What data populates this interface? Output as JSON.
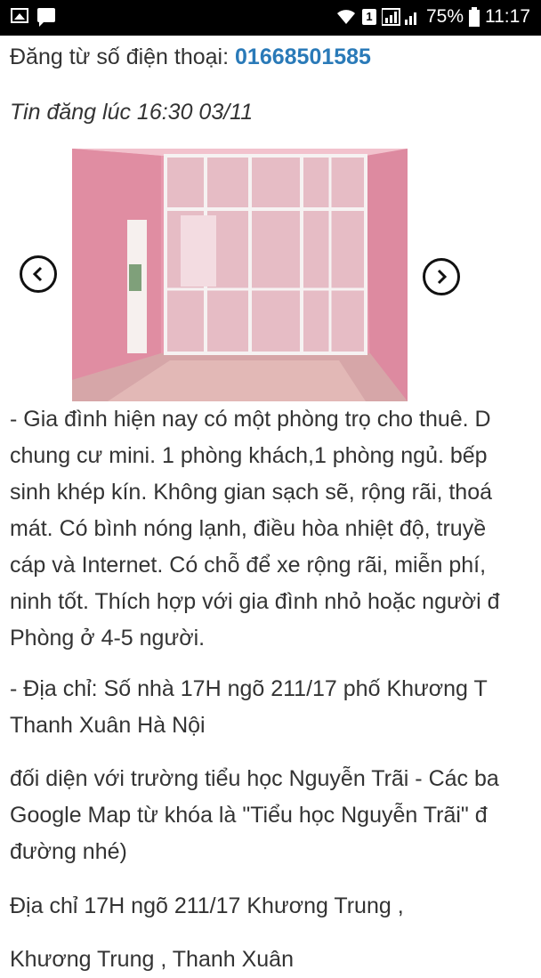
{
  "status_bar": {
    "badge": "1",
    "battery_percent": "75%",
    "time": "11:17"
  },
  "post": {
    "phone_label": "Đăng từ số điện thoại: ",
    "phone_number": "01668501585",
    "posted_time": "Tin đăng lúc 16:30 03/11"
  },
  "description": {
    "lines": [
      "- Gia đình hiện nay có một phòng trọ cho thuê. D",
      "chung cư mini. 1 phòng khách,1 phòng ngủ. bếp",
      "sinh khép kín.  Không gian sạch sẽ, rộng rãi, thoá",
      "mát. Có bình nóng lạnh, điều hòa nhiệt độ, truyề",
      "cáp và Internet. Có chỗ để xe rộng rãi, miễn phí, ",
      "ninh tốt. Thích hợp với gia đình nhỏ hoặc người đ",
      "Phòng ở 4-5 người."
    ],
    "address_lines": [
      "- Địa chỉ: Số nhà 17H ngõ 211/17 phố Khương T",
      "Thanh Xuân Hà Nội"
    ],
    "directions_lines": [
      "đối diện với trường tiểu học Nguyễn Trãi - Các ba",
      "Google Map từ khóa là \"Tiểu học Nguyễn Trãi\" đ",
      "đường nhé)"
    ],
    "address2": "Địa chỉ 17H ngõ 211/17 Khương Trung ,",
    "address3": "Khương Trung , Thanh Xuân"
  }
}
